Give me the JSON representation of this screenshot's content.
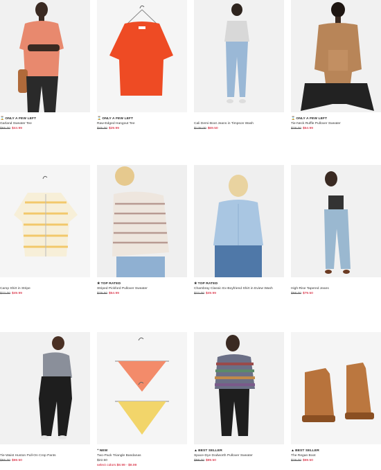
{
  "products": [
    {
      "badge": "ONLY A FEW LEFT",
      "badge_icon": "hourglass-icon",
      "badge_glyph": "⌛",
      "name": "Garland Sweater Tee",
      "was": "$65.00",
      "now": "$44.99"
    },
    {
      "badge": "ONLY A FEW LEFT",
      "badge_icon": "hourglass-icon",
      "badge_glyph": "⌛",
      "name": "Raw-Edged Hangout Tee",
      "was": "$45.00",
      "now": "$29.99"
    },
    {
      "badge": "",
      "badge_icon": "",
      "badge_glyph": "",
      "name": "Cali Demi-Boot Jeans in Timpson Wash",
      "was": "$128.00",
      "now": "$69.50"
    },
    {
      "badge": "ONLY A FEW LEFT",
      "badge_icon": "hourglass-icon",
      "badge_glyph": "⌛",
      "name": "Tie-Neck Ruffle Pullover Sweater",
      "was": "$78.00",
      "now": "$54.99"
    },
    {
      "badge": "",
      "badge_icon": "",
      "badge_glyph": "",
      "name": "Camp Shirt in Stripe",
      "was": "$72.00",
      "now": "$49.99"
    },
    {
      "badge": "TOP RATED",
      "badge_icon": "star-icon",
      "badge_glyph": "★",
      "name": "Striped Pickford Pullover Sweater",
      "was": "$79.50",
      "now": "$54.99"
    },
    {
      "badge": "TOP RATED",
      "badge_icon": "star-icon",
      "badge_glyph": "★",
      "name": "Chambray Classic Ex-Boyfriend Shirt in Eview Wash",
      "was": "$72.00",
      "now": "$49.99"
    },
    {
      "badge": "",
      "badge_icon": "",
      "badge_glyph": "",
      "name": "High-Rise Tapered Jeans",
      "was": "$98.00",
      "now": "$79.50"
    },
    {
      "badge": "",
      "badge_icon": "",
      "badge_glyph": "",
      "name": "Tie-Waist Huston Pull-On Crop Pants",
      "was": "$85.00",
      "now": "$69.50"
    },
    {
      "badge": "NEW",
      "badge_icon": "sparkle-icon",
      "badge_glyph": "⁺",
      "name": "Two-Pack Triangle Bandanas",
      "was": "",
      "now": "",
      "price_plain": "$22.50",
      "extra": "select colors $8.99 - $8.99"
    },
    {
      "badge": "BEST SELLER",
      "badge_icon": "triangle-icon",
      "badge_glyph": "▲",
      "name": "Space-Dye Dodworth Pullover Sweater",
      "was": "$98.00",
      "now": "$89.50"
    },
    {
      "badge": "BEST SELLER",
      "badge_icon": "triangle-icon",
      "badge_glyph": "▲",
      "name": "The Regan Boot",
      "was": "$78.00",
      "now": "$69.50"
    }
  ]
}
